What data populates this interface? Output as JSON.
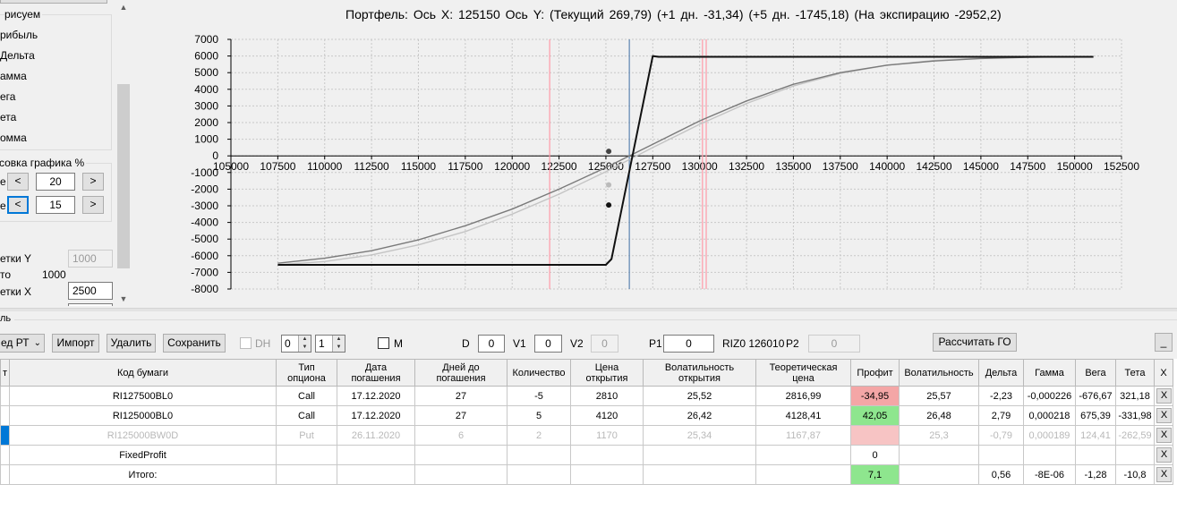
{
  "left_panel": {
    "series_group_title": "рисуем",
    "series": [
      "рибыль",
      "Дельта",
      "амма",
      "ега",
      "ета",
      "омма"
    ],
    "shift_group_title": "совка графика %",
    "row1": {
      "label": "е",
      "prev": "<",
      "value": "20",
      "next": ">"
    },
    "row2": {
      "label": "е",
      "prev": "<",
      "value": "15",
      "next": ">"
    },
    "grid_y_label": "етки Y",
    "grid_y_value": "1000",
    "auto_label": "то",
    "auto_value": "1000",
    "grid_x_label": "етки X",
    "grid_x_value": "2500"
  },
  "chart": {
    "title": "Портфель: Ось X:  125150 Ось Y:  (Текущий 269,79)  (+1 дн. -31,34)  (+5 дн. -1745,18)  (На экспирацию -2952,2)"
  },
  "chart_data": {
    "type": "line",
    "title": "Портфель: Ось X:  125150 Ось Y:  (Текущий 269,79)  (+1 дн. -31,34)  (+5 дн. -1745,18)  (На экспирацию -2952,2)",
    "xlim": [
      105000,
      152500
    ],
    "ylim": [
      -8000,
      7000
    ],
    "x_ticks": [
      "105000",
      "107500",
      "110000",
      "112500",
      "115000",
      "117500",
      "120000",
      "122500",
      "125000",
      "127500",
      "130000",
      "132500",
      "135000",
      "137500",
      "140000",
      "142500",
      "145000",
      "147500",
      "150000",
      "152500"
    ],
    "y_ticks": [
      "7000",
      "6000",
      "5000",
      "4000",
      "3000",
      "2000",
      "1000",
      "0",
      "-1000",
      "-2000",
      "-3000",
      "-4000",
      "-5000",
      "-6000",
      "-7000",
      "-8000"
    ],
    "grid": true,
    "vertical_lines": [
      {
        "x": 122000,
        "color": "#ff9aa8"
      },
      {
        "x": 126250,
        "color": "#5b84b1"
      },
      {
        "x": 130150,
        "color": "#ff9aa8"
      },
      {
        "x": 130350,
        "color": "#ff9aa8"
      }
    ],
    "markers": [
      {
        "x": 125150,
        "y": 270,
        "color": "#444444"
      },
      {
        "x": 125150,
        "y": -1745,
        "color": "#bbbbbb"
      },
      {
        "x": 125150,
        "y": -2952,
        "color": "#111111"
      }
    ],
    "series": [
      {
        "color": "#111111",
        "x": [
          107500,
          125000,
          125300,
          127500,
          127800,
          151000
        ],
        "y": [
          -6550,
          -6550,
          -6200,
          6000,
          5950,
          5950
        ]
      },
      {
        "color": "#7a7a7a",
        "x": [
          107500,
          110000,
          112500,
          115000,
          117500,
          120000,
          122500,
          125000,
          127500,
          130000,
          132500,
          135000,
          137500,
          140000,
          142500,
          145000,
          147500,
          150000,
          151000
        ],
        "y": [
          -6450,
          -6150,
          -5700,
          -5050,
          -4200,
          -3200,
          -2000,
          -700,
          700,
          2100,
          3300,
          4300,
          5000,
          5450,
          5700,
          5850,
          5920,
          5960,
          5970
        ]
      },
      {
        "color": "#c4c4c4",
        "x": [
          107500,
          110000,
          112500,
          115000,
          117500,
          120000,
          122500,
          125000,
          127500,
          130000,
          132500,
          135000,
          137500,
          140000,
          142500,
          145000,
          147500,
          150000,
          151000
        ],
        "y": [
          -6550,
          -6350,
          -5950,
          -5350,
          -4550,
          -3500,
          -2300,
          -950,
          500,
          1900,
          3150,
          4200,
          4950,
          5450,
          5730,
          5880,
          5940,
          5960,
          5970
        ]
      }
    ]
  },
  "portfolio": {
    "group_title": "ль",
    "combo_value": "ед РТ",
    "import_label": "Импорт",
    "delete_label": "Удалить",
    "save_label": "Сохранить",
    "dh_label": "DH",
    "spin1": "0",
    "spin2": "1",
    "m_label": "M",
    "d_label": "D",
    "d_value": "0",
    "v1_label": "V1",
    "v1_value": "0",
    "v2_label": "V2",
    "v2_value": "0",
    "p1_label": "P1",
    "p1_value": "0",
    "futures_label": "RIZ0 126010",
    "p2_label": "P2",
    "p2_value": "0",
    "calc_label": "Рассчитать ГО",
    "minimize_label": "_"
  },
  "table": {
    "columns": [
      "т",
      "Код бумаги",
      "Тип опциона",
      "Дата погашения",
      "Дней до погашения",
      "Количество",
      "Цена открытия",
      "Волатильность открытия",
      "Теоретическая цена",
      "Профит",
      "Волатильность",
      "Дельта",
      "Гамма",
      "Вега",
      "Тета",
      "X"
    ],
    "rows": [
      [
        "",
        "RI127500BL0",
        "Call",
        "17.12.2020",
        "27",
        "-5",
        "2810",
        "25,52",
        "2816,99",
        "-34,95",
        "25,57",
        "-2,23",
        "-0,000226",
        "-676,67",
        "321,18",
        "X"
      ],
      [
        "",
        "RI125000BL0",
        "Call",
        "17.12.2020",
        "27",
        "5",
        "4120",
        "26,42",
        "4128,41",
        "42,05",
        "26,48",
        "2,79",
        "0,000218",
        "675,39",
        "-331,98",
        "X"
      ],
      [
        "",
        "RI125000BW0D",
        "Put",
        "26.11.2020",
        "6",
        "2",
        "1170",
        "25,34",
        "1167,87",
        "",
        "25,3",
        "-0,79",
        "0,000189",
        "124,41",
        "-262,59",
        "X"
      ],
      [
        "",
        "FixedProfit",
        "",
        "",
        "",
        "",
        "",
        "",
        "",
        "0",
        "",
        "",
        "",
        "",
        "",
        "X"
      ],
      [
        "",
        "Итого:",
        "",
        "",
        "",
        "",
        "",
        "",
        "",
        "7,1",
        "",
        "0,56",
        "-8E-06",
        "-1,28",
        "-10,8",
        "X"
      ]
    ],
    "profit_colors": [
      "#f4a6a6",
      "#8ee68e",
      "#f7c4c4",
      "#ffffff",
      "#8ee68e"
    ]
  }
}
